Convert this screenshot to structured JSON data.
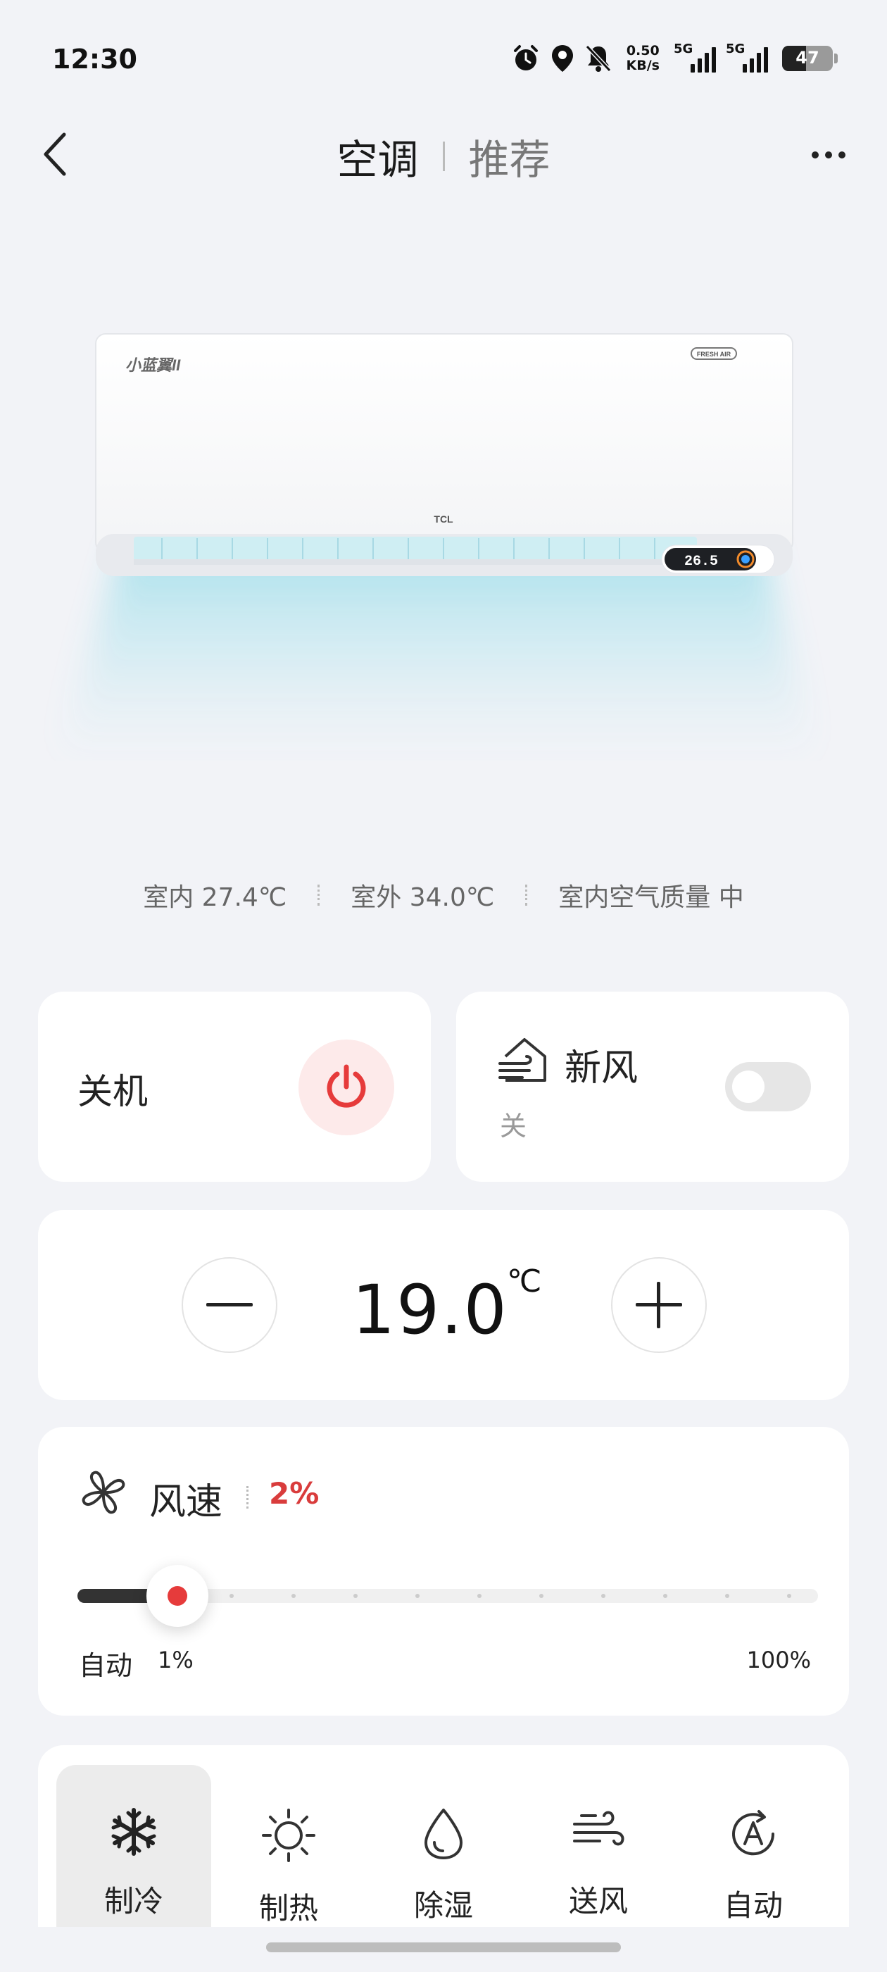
{
  "status_bar": {
    "time": "12:30",
    "net_speed_value": "0.50",
    "net_speed_unit": "KB/s",
    "sim1_label": "5G",
    "sim2_label": "5G",
    "battery": "47",
    "icons": [
      "alarm-icon",
      "location-icon",
      "mute-bell-icon",
      "signal-icon",
      "battery-icon"
    ]
  },
  "header": {
    "tab_active": "空调",
    "tab_inactive": "推荐",
    "back_icon": "chevron-left-icon",
    "more_icon": "more-dots-icon"
  },
  "device": {
    "brand_small": "小蓝翼II",
    "brand": "TCL",
    "badge": "FRESH AIR",
    "display_temp": "26.5"
  },
  "environment": {
    "indoor": "室内 27.4℃",
    "outdoor": "室外 34.0℃",
    "air_quality": "室内空气质量  中"
  },
  "power": {
    "label": "关机",
    "accent": "#e63b3b"
  },
  "fresh_air": {
    "title": "新风",
    "status": "关",
    "enabled": false
  },
  "temperature": {
    "value": "19.0",
    "unit": "℃"
  },
  "fan_speed": {
    "title": "风速",
    "value": "2%",
    "level": 0.02,
    "min_label": "自动",
    "min_value": "1%",
    "max_value": "100%"
  },
  "modes": [
    {
      "label": "制冷",
      "icon": "snowflake-icon",
      "active": true
    },
    {
      "label": "制热",
      "icon": "sun-icon",
      "active": false
    },
    {
      "label": "除湿",
      "icon": "water-drop-icon",
      "active": false
    },
    {
      "label": "送风",
      "icon": "wind-icon",
      "active": false
    },
    {
      "label": "自动",
      "icon": "auto-mode-icon",
      "active": false
    }
  ]
}
